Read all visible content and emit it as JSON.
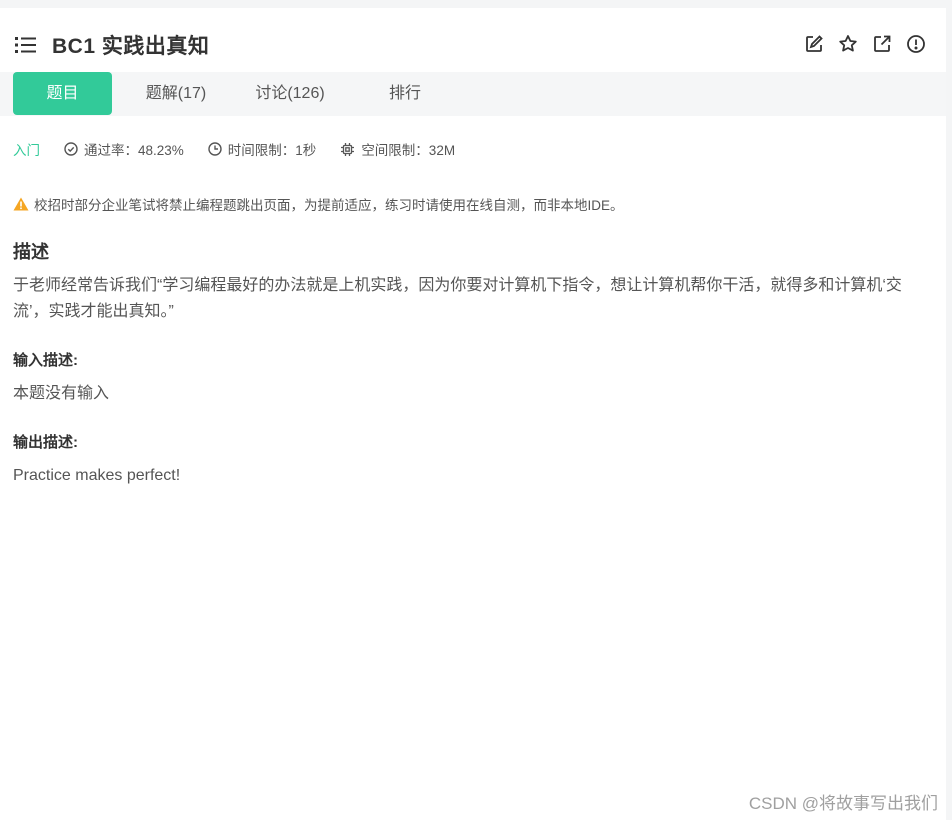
{
  "header": {
    "title": "BC1  实践出真知",
    "icons": [
      "list-icon",
      "edit-icon",
      "star-icon",
      "external-link-icon",
      "info-circle-icon"
    ]
  },
  "tabs": [
    {
      "label": "题目",
      "active": true
    },
    {
      "label": "题解(17)",
      "active": false
    },
    {
      "label": "讨论(126)",
      "active": false
    },
    {
      "label": "排行",
      "active": false
    }
  ],
  "meta": {
    "difficulty": "入门",
    "pass_rate": "通过率：48.23%",
    "time_limit": "时间限制：1秒",
    "memory_limit": "空间限制：32M"
  },
  "warning": "校招时部分企业笔试将禁止编程题跳出页面，为提前适应，练习时请使用在线自测，而非本地IDE。",
  "description": {
    "title": "描述",
    "text": "于老师经常告诉我们“学习编程最好的办法就是上机实践，因为你要对计算机下指令，想让计算机帮你干活，就得多和计算机‘交流’，实践才能出真知。”"
  },
  "input": {
    "title": "输入描述:",
    "text": "本题没有输入"
  },
  "output": {
    "title": "输出描述:",
    "text": "Practice makes perfect!"
  },
  "watermark": "CSDN @将故事写出我们",
  "colors": {
    "accent": "#32ca99",
    "warning": "#f5a623",
    "text": "#555555",
    "heading": "#333333"
  }
}
